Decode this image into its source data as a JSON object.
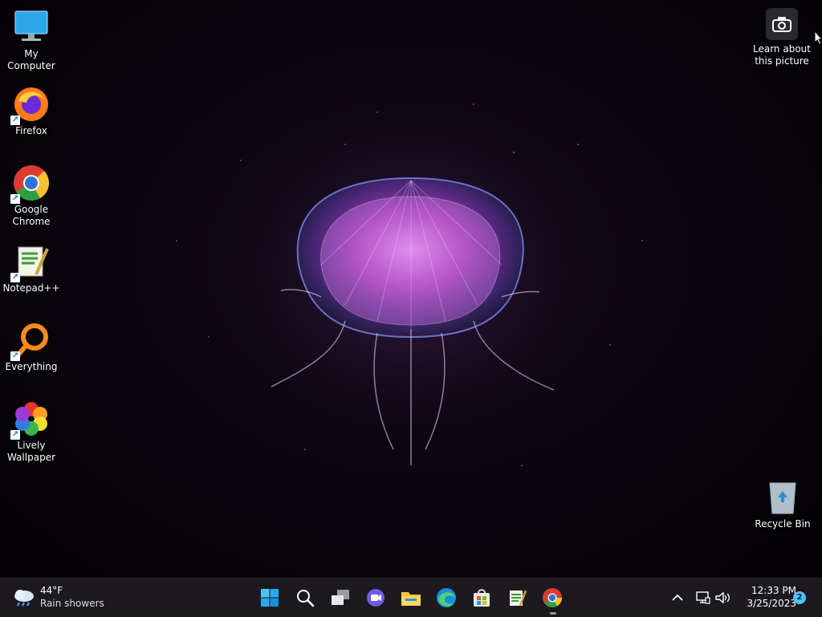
{
  "desktop": {
    "icons": [
      {
        "label": "My Computer",
        "icon": "monitor-icon"
      },
      {
        "label": "Firefox",
        "icon": "firefox-icon"
      },
      {
        "label": "Google\nChrome",
        "icon": "chrome-icon"
      },
      {
        "label": "Notepad++",
        "icon": "notepadpp-icon"
      },
      {
        "label": "Everything",
        "icon": "search-ring-icon"
      },
      {
        "label": "Lively\nWallpaper",
        "icon": "lively-icon"
      },
      {
        "label": "Recycle Bin",
        "icon": "recycle-bin-icon"
      }
    ],
    "learn_picture": {
      "line1": "Learn about",
      "line2": "this picture"
    }
  },
  "taskbar": {
    "weather": {
      "temp": "44°F",
      "condition": "Rain showers"
    },
    "apps": [
      "start-icon",
      "search-icon",
      "task-view-icon",
      "chat-icon",
      "file-explorer-icon",
      "edge-icon",
      "store-icon",
      "notepadpp-icon",
      "chrome-icon"
    ],
    "tray": {
      "time": "12:33 PM",
      "date": "3/25/2023",
      "notifications": "2"
    }
  },
  "colors": {
    "taskbar": "#1c1a1f",
    "accent": "#0078d4",
    "jelly": "#d070e0"
  }
}
